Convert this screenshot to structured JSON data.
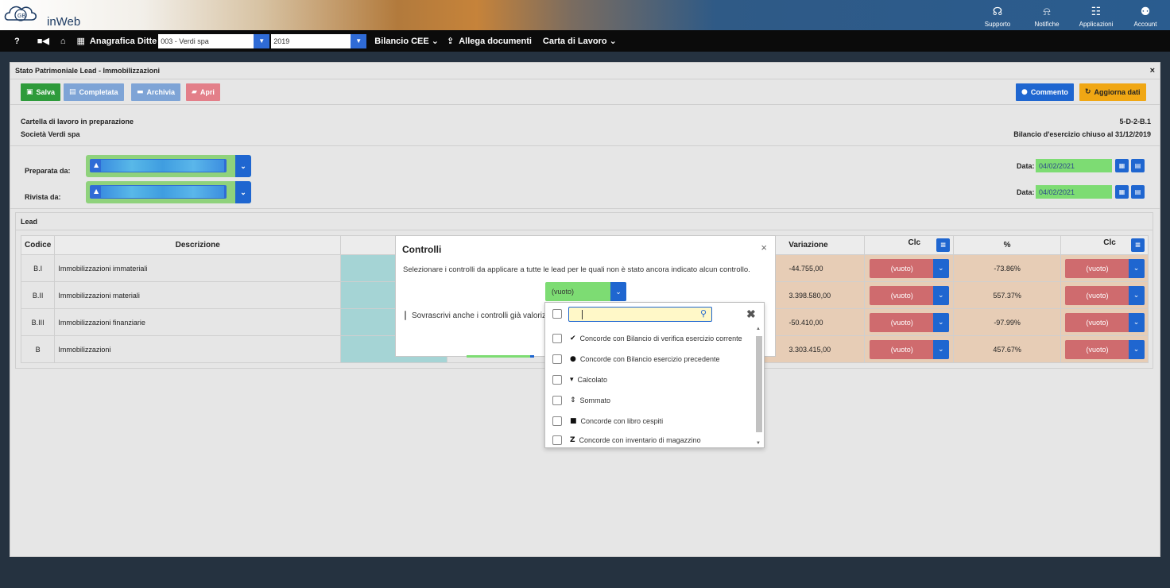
{
  "app": {
    "name": "inWeb",
    "logo_initials": "GB"
  },
  "topbar": {
    "items": [
      {
        "label": "Supporto",
        "icon": "headset-icon",
        "glyph": "☊"
      },
      {
        "label": "Notifiche",
        "icon": "bell-icon",
        "glyph": "⍾"
      },
      {
        "label": "Applicazioni",
        "icon": "apps-grid-icon",
        "glyph": "☷"
      },
      {
        "label": "Account",
        "icon": "account-icon",
        "glyph": "⚉"
      }
    ]
  },
  "nav": {
    "help": "?",
    "company_label": "Anagrafica Ditte",
    "company_value": "003 - Verdi spa",
    "year_value": "2019",
    "bilancio": "Bilancio CEE",
    "allega": "Allega documenti",
    "carta": "Carta di Lavoro"
  },
  "panel": {
    "title": "Stato Patrimoniale Lead - Immobilizzazioni",
    "close": "×",
    "buttons": {
      "salva": "Salva",
      "completata": "Completata",
      "archivia": "Archivia",
      "apri": "Apri",
      "commento": "Commento",
      "aggiorna": "Aggiorna dati"
    },
    "status": "Cartella di lavoro in preparazione",
    "company": "Società Verdi spa",
    "code": "5-D-2-B.1",
    "period": "Bilancio d'esercizio chiuso al 31/12/2019",
    "prepared_label": "Preparata da:",
    "reviewed_label": "Rivista da:",
    "date_label": "Data:",
    "prepared_date": "04/02/2021",
    "reviewed_date": "04/02/2021"
  },
  "lead": {
    "title": "Lead",
    "columns": {
      "codice": "Codice",
      "descrizione": "Descrizione",
      "variazione": "Variazione",
      "clc": "Clc",
      "percent": "%",
      "clc2": "Clc"
    },
    "rows": [
      {
        "code": "B.I",
        "desc": "Immobilizzazioni immateriali",
        "variation": "-44.755,00",
        "clc": "(vuoto)",
        "pct": "-73.86%",
        "clc2": "(vuoto)"
      },
      {
        "code": "B.II",
        "desc": "Immobilizzazioni materiali",
        "variation": "3.398.580,00",
        "clc": "(vuoto)",
        "pct": "557.37%",
        "clc2": "(vuoto)"
      },
      {
        "code": "B.III",
        "desc": "Immobilizzazioni finanziarie",
        "variation": "-50.410,00",
        "clc": "(vuoto)",
        "pct": "-97.99%",
        "clc2": "(vuoto)"
      },
      {
        "code": "B",
        "desc": "Immobilizzazioni",
        "variation": "3.303.415,00",
        "clc": "(vuoto)",
        "pct": "457.67%",
        "clc2": "(vuoto)"
      }
    ]
  },
  "modal": {
    "title": "Controlli",
    "close": "×",
    "description": "Selezionare i controlli da applicare a tutte le lead per le quali non è stato ancora indicato alcun controllo.",
    "select_value": "(vuoto)",
    "overwrite": "Sovrascrivi anche i controlli già valorizzati"
  },
  "dropdown": {
    "search_value": "",
    "options": [
      {
        "label": "Concorde con Bilancio di verifica esercizio corrente",
        "glyph": "✔",
        "icon": "check-icon"
      },
      {
        "label": "Concorde con Bilancio esercizio precedente",
        "glyph": "●",
        "icon": "circle-icon"
      },
      {
        "label": "Calcolato",
        "glyph": "▾",
        "icon": "caret-down-icon"
      },
      {
        "label": "Sommato",
        "glyph": "⇕",
        "icon": "sort-icon"
      },
      {
        "label": "Concorde con libro cespiti",
        "glyph": "■",
        "icon": "square-icon"
      },
      {
        "label": "Concorde con inventario di magazzino",
        "glyph": "Z",
        "icon": "z-icon"
      }
    ]
  },
  "colors": {
    "primary": "#1f66d0",
    "green": "#7ddc73",
    "red": "#cc6f71",
    "teal": "#a5d4d5",
    "orange": "#e7cdb6",
    "yellow": "#f0a714"
  }
}
